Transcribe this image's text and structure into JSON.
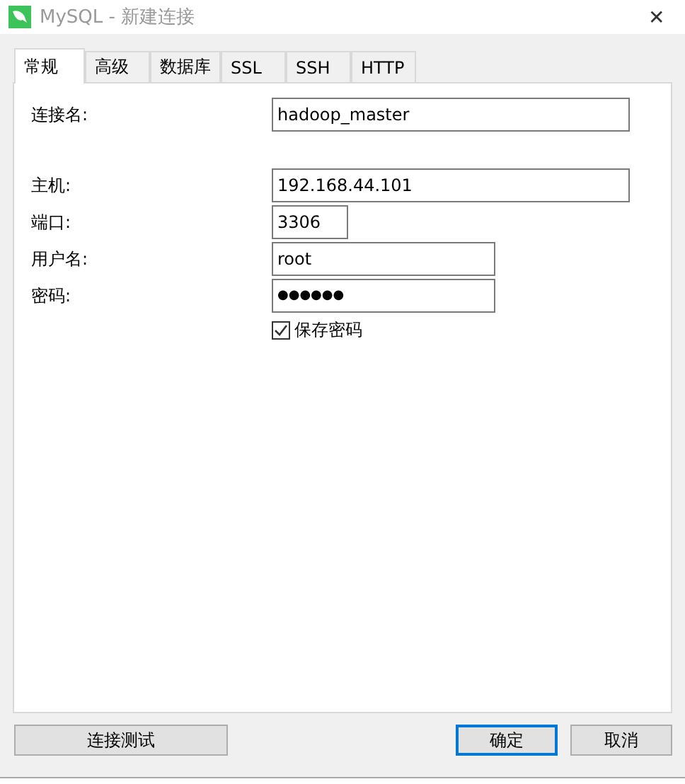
{
  "window": {
    "title": "MySQL - 新建连接",
    "close": "✕"
  },
  "tabs": [
    {
      "label": "常规",
      "selected": true
    },
    {
      "label": "高级",
      "selected": false
    },
    {
      "label": "数据库",
      "selected": false
    },
    {
      "label": "SSL",
      "selected": false
    },
    {
      "label": "SSH",
      "selected": false
    },
    {
      "label": "HTTP",
      "selected": false
    }
  ],
  "fields": [
    {
      "label": "连接名:",
      "value": "hadoop_master"
    },
    {
      "label": "主机:",
      "value": "192.168.44.101"
    },
    {
      "label": "端口:",
      "value": "3306"
    },
    {
      "label": "用户名:",
      "value": "root"
    },
    {
      "label": "密码:",
      "value": "●●●●●●"
    }
  ],
  "save_password": {
    "label": "保存密码",
    "checked": true
  },
  "buttons": [
    {
      "label": "连接测试",
      "focused": false
    },
    {
      "label": "确定",
      "focused": true
    },
    {
      "label": "取消",
      "focused": false
    }
  ]
}
